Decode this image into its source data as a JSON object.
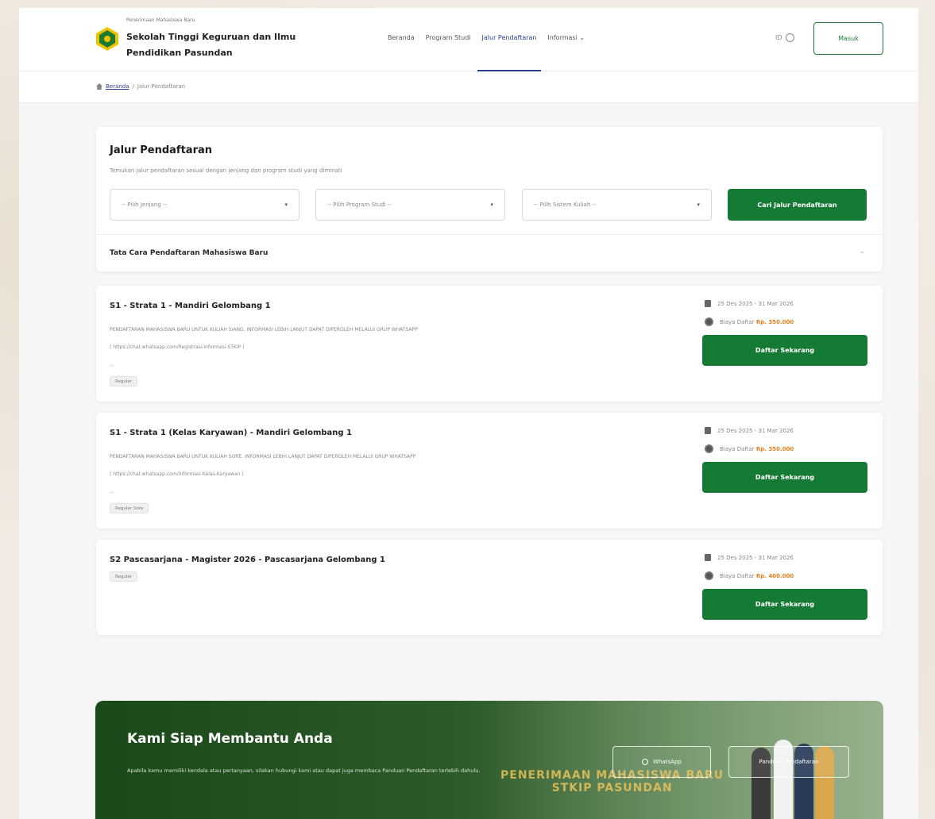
{
  "header": {
    "brand_small": "Penerimaan Mahasiswa Baru",
    "brand_name": "Sekolah Tinggi Keguruan dan Ilmu Pendidikan Pasundan",
    "nav": [
      {
        "label": "Beranda"
      },
      {
        "label": "Program Studi"
      },
      {
        "label": "Jalur Pendaftaran"
      },
      {
        "label": "Informasi ⌄"
      }
    ],
    "lang": "ID",
    "login_label": "Masuk"
  },
  "breadcrumb": {
    "home": "Beranda",
    "sep": "/",
    "current": "Jalur Pendaftaran"
  },
  "filter": {
    "title": "Jalur Pendaftaran",
    "subtitle": "Temukan jalur pendaftaran sesuai dengan jenjang dan program studi yang diminati",
    "select_jenjang": "-- Pilih Jenjang --",
    "select_prodi": "-- Pilih Program Studi --",
    "select_sistem": "-- Pilih Sistem Kuliah --",
    "caret": "▾",
    "search_label": "Cari Jalur Pendaftaran",
    "accordion_label": "Tata Cara Pendaftaran Mahasiswa Baru",
    "accordion_chevron": "⌄"
  },
  "programs": [
    {
      "title": "S1 - Strata 1 - Mandiri Gelombang 1",
      "desc_line1": "PENDAFTARAN MAHASISWA BARU UNTUK KULIAH SIANG. INFORMASI LEBIH LANJUT DAPAT DIPEROLEH MELALUI GRUP WHATSAPP",
      "desc_line2": "( https://chat.whatsapp.com/Registrasi-Informasi-STKIP )",
      "desc_line3": "...",
      "badge": "Reguler",
      "date": "25 Des 2025 - 31 Mar 2026",
      "fee_label": "Biaya Daftar",
      "fee": "Rp. 350.000",
      "apply": "Daftar Sekarang"
    },
    {
      "title": "S1 - Strata 1 (Kelas Karyawan) - Mandiri Gelombang 1",
      "desc_line1": "PENDAFTARAN MAHASISWA BARU UNTUK KULIAH SORE. INFORMASI LEBIH LANJUT DAPAT DIPEROLEH MELALUI GRUP WHATSAPP",
      "desc_line2": "( https://chat.whatsapp.com/Informasi-Kelas-Karyawan )",
      "desc_line3": "...",
      "badge": "Reguler Sore",
      "date": "25 Des 2025 - 31 Mar 2026",
      "fee_label": "Biaya Daftar",
      "fee": "Rp. 350.000",
      "apply": "Daftar Sekarang"
    },
    {
      "title": "S2 Pascasarjana - Magister 2026 - Pascasarjana Gelombang 1",
      "badge": "Reguler",
      "date": "25 Des 2025 - 31 Mar 2026",
      "fee_label": "Biaya Daftar",
      "fee": "Rp. 400.000",
      "apply": "Daftar Sekarang"
    }
  ],
  "banner": {
    "title": "Kami Siap Membantu Anda",
    "text": "Apabila kamu memiliki kendala atau pertanyaan, silakan hubungi kami atau dapat juga membaca Panduan Pendaftaran terlebih dahulu.",
    "whatsapp_label": "WhatsApp",
    "guide_label": "Panduan Pendaftaran",
    "poster_line1": "PENERIMAAN MAHASISWA BARU",
    "poster_line2": "STKIP PASUNDAN"
  },
  "colors": {
    "primary_green": "#157a33",
    "nav_active": "#2c3e8f",
    "fee_orange": "#e8801f"
  }
}
